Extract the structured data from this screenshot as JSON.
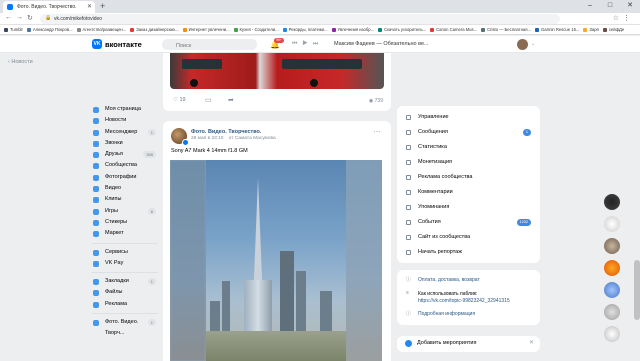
{
  "browser": {
    "tab_title": "Фото. Видео. Творчество.",
    "url": "vk.com/mikefotovideo",
    "bookmarks": [
      {
        "label": "Tumblr",
        "color": "#36465d"
      },
      {
        "label": "Александр Покров...",
        "color": "#4a76a8"
      },
      {
        "label": "Агентство/размещен...",
        "color": "#888"
      },
      {
        "label": "Заказ дизайнерских...",
        "color": "#e53935"
      },
      {
        "label": "Интернет увлечени...",
        "color": "#fb8c00"
      },
      {
        "label": "Кухня - Создатели...",
        "color": "#43a047"
      },
      {
        "label": "Рекорды, платежи...",
        "color": "#1e88e5"
      },
      {
        "label": "Увлечения изобр...",
        "color": "#8e24aa"
      },
      {
        "label": "Скачать ускоритель...",
        "color": "#00897b"
      },
      {
        "label": "Canon Camera Mus...",
        "color": "#e53935"
      },
      {
        "label": "Cristo — Бесплатная...",
        "color": "#546e7a"
      },
      {
        "label": "Garmin Rescue 15...",
        "color": "#1565c0"
      },
      {
        "label": "Заря",
        "color": "#f9a825"
      },
      {
        "label": "сейфДе",
        "color": "#6d4c41"
      }
    ]
  },
  "header": {
    "logo_text": "вконтакте",
    "search_placeholder": "Поиск",
    "notif_count": "99+",
    "now_playing": "Максим Фадеев — Обязательно ве..."
  },
  "left": {
    "back_label": "Новости",
    "nav": [
      {
        "label": "Моя страница",
        "count": ""
      },
      {
        "label": "Новости",
        "count": ""
      },
      {
        "label": "Мессенджер",
        "count": "1"
      },
      {
        "label": "Звонки",
        "count": ""
      },
      {
        "label": "Друзья",
        "count": "395"
      },
      {
        "label": "Сообщества",
        "count": ""
      },
      {
        "label": "Фотографии",
        "count": ""
      },
      {
        "label": "Видео",
        "count": ""
      },
      {
        "label": "Клипы",
        "count": ""
      },
      {
        "label": "Игры",
        "count": "6"
      },
      {
        "label": "Стикеры",
        "count": ""
      },
      {
        "label": "Маркет",
        "count": ""
      }
    ],
    "nav2": [
      {
        "label": "Сервисы",
        "count": ""
      },
      {
        "label": "VK Pay",
        "count": ""
      }
    ],
    "nav3": [
      {
        "label": "Закладки",
        "count": "1"
      },
      {
        "label": "Файлы",
        "count": ""
      },
      {
        "label": "Реклама",
        "count": ""
      }
    ],
    "nav4": [
      {
        "label": "Фото. Видео. Творч...",
        "count": "1"
      }
    ]
  },
  "post1": {
    "likes": "19",
    "views": "739"
  },
  "post2": {
    "author": "Фото. Видео. Творчество.",
    "time": "28 мая в 23:10",
    "from": "от Самата Масумова",
    "text": "Sony A7 Mark 4 14mm f1.8 GM"
  },
  "right_menu": [
    {
      "label": "Управление",
      "count": ""
    },
    {
      "label": "Сообщения",
      "count": "1"
    },
    {
      "label": "Статистика",
      "count": ""
    },
    {
      "label": "Монетизация",
      "count": ""
    },
    {
      "label": "Реклама сообщества",
      "count": ""
    },
    {
      "label": "Комментарии",
      "count": ""
    },
    {
      "label": "Упоминания",
      "count": ""
    },
    {
      "label": "События",
      "count": "1232"
    },
    {
      "label": "Сайт из сообщества",
      "count": ""
    },
    {
      "label": "Начать репортаж",
      "count": ""
    }
  ],
  "right_info": {
    "payment": "Оплата, доставка, возврат",
    "howto_title": "Как использовать паблик:",
    "howto_link": "https://vk.com/topic-99823242_32941315",
    "more": "Подробная информация"
  },
  "add_event": "Добавить мероприятия",
  "colors": {
    "accent": "#0077ff",
    "link": "#2a5885",
    "badge": "#3f8ae0"
  }
}
